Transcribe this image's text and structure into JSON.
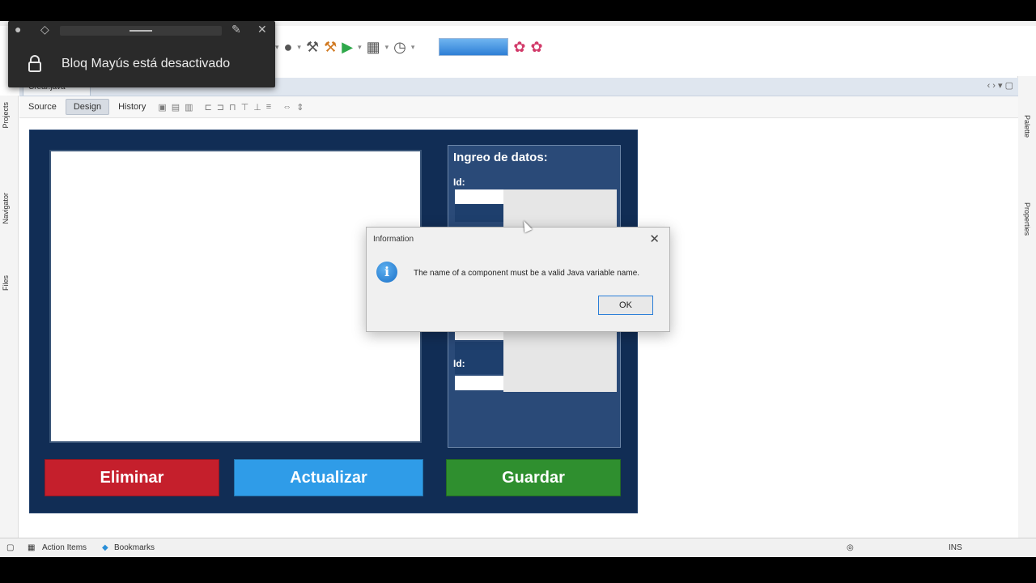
{
  "notification": {
    "text": "Bloq Mayús está desactivado"
  },
  "editor": {
    "file_tab": "Crear.java",
    "design_tabs": {
      "source": "Source",
      "design": "Design",
      "history": "History"
    }
  },
  "left_sidebar": {
    "projects": "Projects",
    "navigator": "Navigator",
    "files": "Files"
  },
  "right_sidebar": {
    "palette": "Palette",
    "properties": "Properties"
  },
  "form": {
    "data_panel_title": "Ingreo de datos:",
    "field_label_1": "Id:",
    "field_label_2": "Id:",
    "buttons": {
      "eliminar": "Eliminar",
      "actualizar": "Actualizar",
      "guardar": "Guardar"
    },
    "colors": {
      "background": "#112d55",
      "eliminar": "#c51f2c",
      "actualizar": "#2f9ce8",
      "guardar": "#2f8f2f"
    }
  },
  "dialog": {
    "title": "Information",
    "message": "The name of a component must be a valid Java variable name.",
    "ok_label": "OK",
    "icon": "info-icon"
  },
  "statusbar": {
    "action_items": "Action Items",
    "bookmarks": "Bookmarks",
    "ins": "INS"
  }
}
